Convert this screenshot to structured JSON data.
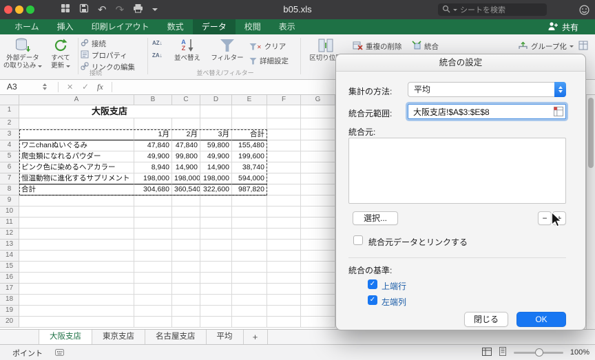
{
  "titlebar": {
    "title": "b05.xls",
    "search_placeholder": "シートを検索"
  },
  "ribbon": {
    "tabs": [
      {
        "label": "ホーム",
        "selected": false
      },
      {
        "label": "挿入",
        "selected": false
      },
      {
        "label": "印刷レイアウト",
        "selected": false
      },
      {
        "label": "数式",
        "selected": false
      },
      {
        "label": "データ",
        "selected": true
      },
      {
        "label": "校閲",
        "selected": false
      },
      {
        "label": "表示",
        "selected": false
      }
    ],
    "share_label": "共有",
    "external_line1": "外部データ",
    "external_line2": "の取り込み",
    "refresh_line1": "すべて",
    "refresh_line2": "更新",
    "connections_label": "接続",
    "properties_label": "プロパティ",
    "edit_links_label": "リンクの編集",
    "connections_group_label": "接続",
    "sort_label": "並べ替え",
    "filter_label": "フィルター",
    "clear_label": "クリア",
    "advanced_label": "詳細設定",
    "sort_filter_group_label": "並べ替え/フィルター",
    "text_to_columns_label": "区切り位置",
    "remove_duplicates_label": "重複の削除",
    "consolidate_label": "統合",
    "group_label": "グループ化"
  },
  "formula_bar": {
    "cell_ref": "A3",
    "fx_label": "fx"
  },
  "sheet": {
    "columns": [
      "A",
      "B",
      "C",
      "D",
      "E",
      "F",
      "G"
    ],
    "row_count": 20,
    "title": "大阪支店",
    "table": {
      "header": [
        "",
        "1月",
        "2月",
        "3月",
        "合計"
      ],
      "rows": [
        [
          "ワニchanぬいぐるみ",
          "47,840",
          "47,840",
          "59,800",
          "155,480"
        ],
        [
          "爬虫類になれるパウダー",
          "49,900",
          "99,800",
          "49,900",
          "199,600"
        ],
        [
          "ピンク色に染めるヘアカラー",
          "8,940",
          "14,900",
          "14,900",
          "38,740"
        ],
        [
          "恒温動物に進化するサプリメント",
          "198,000",
          "198,000",
          "198,000",
          "594,000"
        ],
        [
          "合計",
          "304,680",
          "360,540",
          "322,600",
          "987,820"
        ]
      ]
    }
  },
  "dialog": {
    "title": "統合の設定",
    "function_label": "集計の方法:",
    "function_value": "平均",
    "reference_label": "統合元範囲:",
    "reference_value": "大阪支店!$A$3:$E$8",
    "all_references_label": "統合元:",
    "select_button": "選択...",
    "minus_button": "−",
    "plus_button": "+",
    "link_checkbox_label": "統合元データとリンクする",
    "use_labels_label": "統合の基準:",
    "top_row_label": "上端行",
    "left_column_label": "左端列",
    "close_button": "閉じる",
    "ok_button": "OK"
  },
  "sheet_tabs": {
    "tabs": [
      {
        "label": "大阪支店",
        "active": true
      },
      {
        "label": "東京支店",
        "active": false
      },
      {
        "label": "名古屋支店",
        "active": false
      },
      {
        "label": "平均",
        "active": false
      }
    ],
    "add_label": "+"
  },
  "status_bar": {
    "mode_label": "ポイント",
    "zoom_label": "100%"
  },
  "colors": {
    "ribbon_green": "#1e7145",
    "ribbon_tab_selected": "#175b38",
    "accent_blue": "#1877f2",
    "ok_button_blue": "#1877f2"
  }
}
